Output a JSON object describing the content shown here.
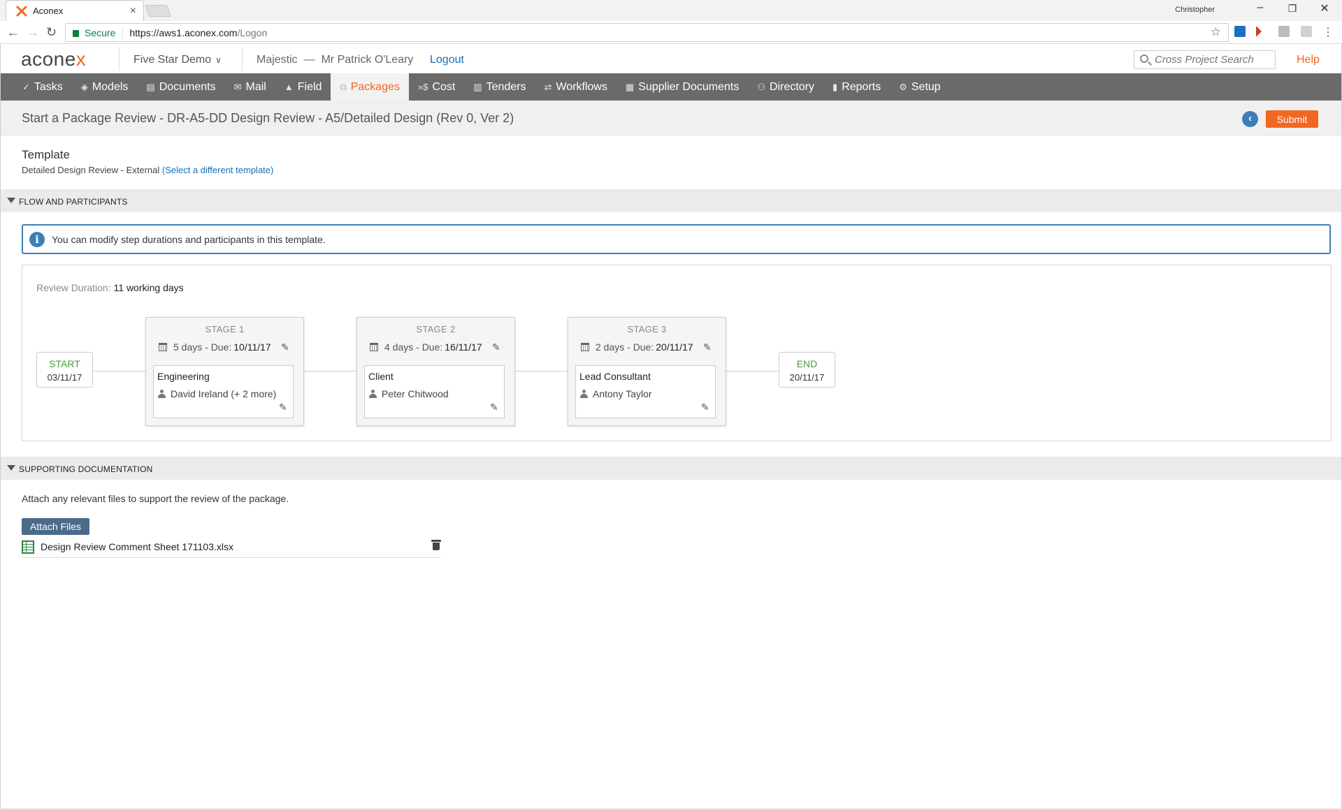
{
  "browser": {
    "tab_title": "Aconex",
    "tab_close": "×",
    "profile_name": "Christopher",
    "secure_label": "Secure",
    "url_host": "https://aws1.aconex.com",
    "url_path": "/Logon",
    "win_min": "–",
    "win_restore": "❐",
    "win_close": "✕"
  },
  "header": {
    "logo_pre": "acone",
    "logo_x": "x",
    "project_name": "Five Star Demo",
    "org_user": "Majestic  —  Mr Patrick O'Leary",
    "logout_label": "Logout",
    "search_placeholder": "Cross Project Search",
    "help_label": "Help"
  },
  "nav": {
    "items": [
      {
        "icon": "✓",
        "label": "Tasks"
      },
      {
        "icon": "◈",
        "label": "Models"
      },
      {
        "icon": "▤",
        "label": "Documents"
      },
      {
        "icon": "✉",
        "label": "Mail"
      },
      {
        "icon": "▲",
        "label": "Field"
      },
      {
        "icon": "⧉",
        "label": "Packages"
      },
      {
        "icon": "»$",
        "label": "Cost"
      },
      {
        "icon": "▥",
        "label": "Tenders"
      },
      {
        "icon": "⇄",
        "label": "Workflows"
      },
      {
        "icon": "▦",
        "label": "Supplier Documents"
      },
      {
        "icon": "⚇",
        "label": "Directory"
      },
      {
        "icon": "▮",
        "label": "Reports"
      },
      {
        "icon": "⚙",
        "label": "Setup"
      }
    ],
    "active": "Packages"
  },
  "page": {
    "title": "Start a Package Review - DR-A5-DD Design Review - A5/Detailed Design (Rev 0, Ver 2)",
    "back_label": "‹",
    "submit_label": "Submit"
  },
  "template": {
    "heading": "Template",
    "name": "Detailed Design Review - External",
    "change_link": "(Select a different template)"
  },
  "flow": {
    "section_title": "FLOW AND PARTICIPANTS",
    "info_icon": "i",
    "info_text": "You can modify step durations and participants in this template.",
    "duration_label": "Review Duration:",
    "duration_value": "11",
    "duration_unit": "working days",
    "start": {
      "label": "START",
      "date": "03/11/17"
    },
    "end": {
      "label": "END",
      "date": "20/11/17"
    },
    "stages": [
      {
        "name": "STAGE 1",
        "duration": "5 days - Due:",
        "due": "10/11/17",
        "role": "Engineering",
        "person": "David Ireland (+ 2 more)"
      },
      {
        "name": "STAGE 2",
        "duration": "4 days - Due:",
        "due": "16/11/17",
        "role": "Client",
        "person": "Peter Chitwood"
      },
      {
        "name": "STAGE 3",
        "duration": "2 days - Due:",
        "due": "20/11/17",
        "role": "Lead Consultant",
        "person": "Antony Taylor"
      }
    ]
  },
  "docs": {
    "section_title": "SUPPORTING DOCUMENTATION",
    "description": "Attach any relevant files to support the review of the package.",
    "attach_label": "Attach Files",
    "files": [
      {
        "name": "Design Review Comment Sheet 171103.xlsx"
      }
    ]
  },
  "colors": {
    "accent": "#f26722",
    "nav_bg": "#6a6a6a",
    "link": "#1a6fb5",
    "info_border": "#3c7fb8",
    "endpoint_label": "#4a9a3a"
  }
}
